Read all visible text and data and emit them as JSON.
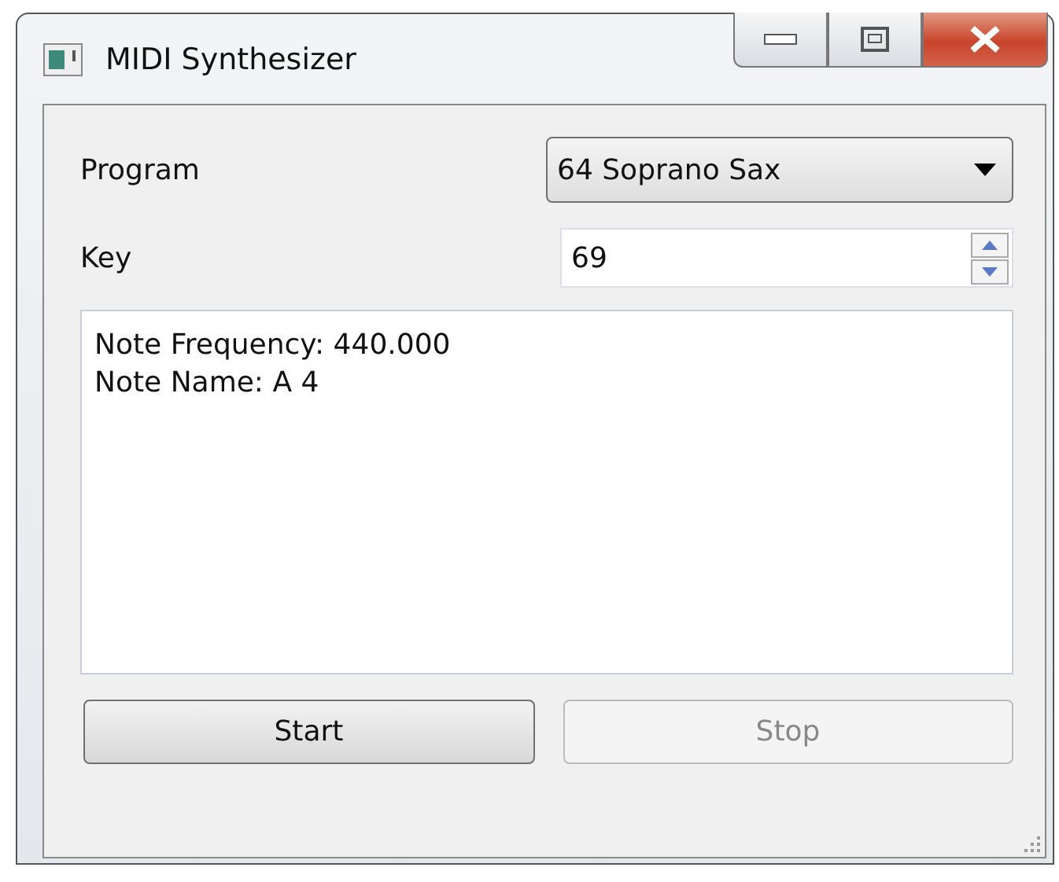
{
  "window": {
    "title": "MIDI Synthesizer"
  },
  "program": {
    "label": "Program",
    "value": "64 Soprano Sax"
  },
  "key": {
    "label": "Key",
    "value": "69"
  },
  "output": {
    "lines": [
      "Note Frequency: 440.000",
      "Note Name: A 4"
    ]
  },
  "buttons": [
    {
      "label": "Start",
      "disabled": false
    },
    {
      "label": "Stop",
      "disabled": true
    }
  ]
}
